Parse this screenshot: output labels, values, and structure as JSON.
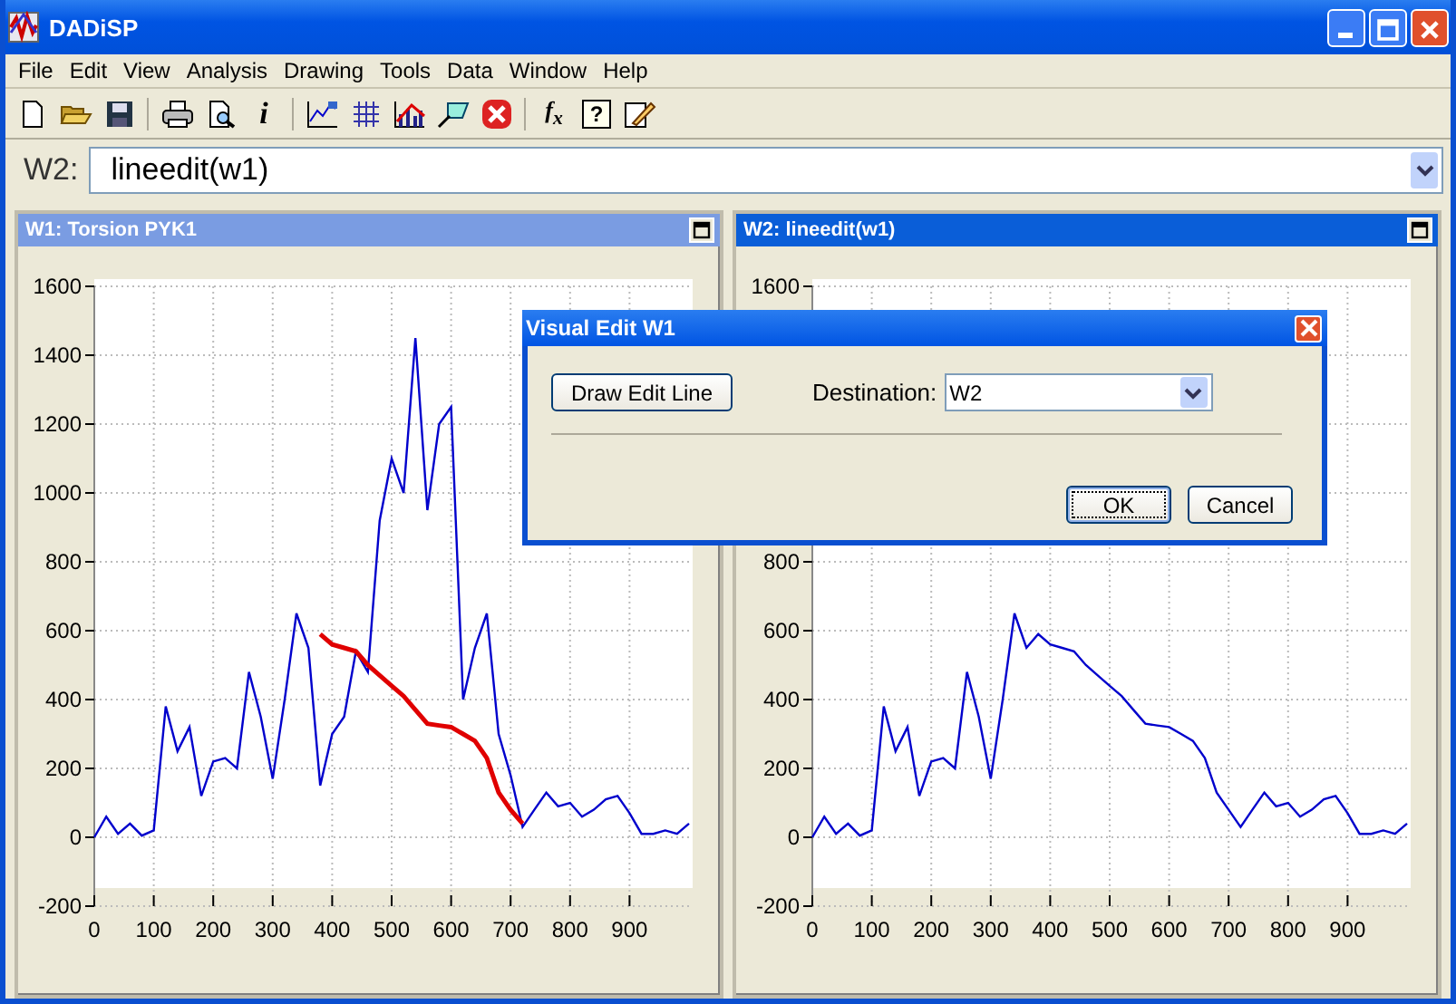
{
  "window": {
    "title": "DADiSP"
  },
  "menu": [
    "File",
    "Edit",
    "View",
    "Analysis",
    "Drawing",
    "Tools",
    "Data",
    "Window",
    "Help"
  ],
  "toolbar": [
    [
      {
        "kind": "new"
      },
      {
        "kind": "open"
      },
      {
        "kind": "save"
      }
    ],
    [
      {
        "kind": "print"
      },
      {
        "kind": "preview"
      },
      {
        "kind": "info",
        "label": "i"
      }
    ],
    [
      {
        "kind": "chart"
      },
      {
        "kind": "grid"
      },
      {
        "kind": "bars"
      },
      {
        "kind": "shape"
      },
      {
        "kind": "stop"
      }
    ],
    [
      {
        "kind": "fx",
        "label": "f$_{x}$"
      },
      {
        "kind": "help",
        "label": "?"
      },
      {
        "kind": "notes"
      }
    ]
  ],
  "formula_bar": {
    "label": "W2:",
    "value": "lineedit(w1)"
  },
  "windows": [
    {
      "title": "W1: Torsion PYK1",
      "active": false,
      "chart_data": {
        "type": "line",
        "grid": true,
        "xlim": [
          0,
          1000
        ],
        "ylim": [
          -200,
          1600
        ],
        "xticks": [
          0,
          100,
          200,
          300,
          400,
          500,
          600,
          700,
          800,
          900
        ],
        "yticks": [
          -200,
          0,
          200,
          400,
          600,
          800,
          1000,
          1200,
          1400,
          1600
        ],
        "x": [
          0,
          20,
          40,
          60,
          80,
          100,
          120,
          140,
          160,
          180,
          200,
          220,
          240,
          260,
          280,
          300,
          320,
          340,
          360,
          380,
          400,
          420,
          440,
          460,
          480,
          500,
          520,
          540,
          560,
          580,
          600,
          620,
          640,
          660,
          680,
          700,
          720,
          740,
          760,
          780,
          800,
          820,
          840,
          860,
          880,
          900,
          920,
          940,
          960,
          980,
          1000
        ],
        "series": [
          {
            "color": "#0000cc",
            "values": [
              0,
              60,
              10,
              40,
              5,
              20,
              380,
              250,
              320,
              120,
              220,
              230,
              200,
              480,
              350,
              170,
              400,
              650,
              550,
              150,
              300,
              350,
              540,
              480,
              920,
              1100,
              1000,
              1450,
              950,
              1200,
              1250,
              400,
              550,
              650,
              300,
              180,
              30,
              80,
              130,
              90,
              100,
              60,
              80,
              110,
              120,
              70,
              10,
              10,
              20,
              10,
              40
            ]
          },
          {
            "color": "#e00000",
            "values": [
              null,
              null,
              null,
              null,
              null,
              null,
              null,
              null,
              null,
              null,
              null,
              null,
              null,
              null,
              null,
              null,
              null,
              null,
              null,
              590,
              560,
              550,
              540,
              500,
              470,
              440,
              410,
              370,
              330,
              325,
              320,
              300,
              280,
              230,
              130,
              80,
              40,
              null,
              null,
              null,
              null,
              null,
              null,
              null,
              null,
              null,
              null,
              null,
              null,
              null,
              null
            ]
          }
        ]
      }
    },
    {
      "title": "W2: lineedit(w1)",
      "active": true,
      "chart_data": {
        "type": "line",
        "grid": true,
        "xlim": [
          0,
          1000
        ],
        "ylim": [
          -200,
          1600
        ],
        "xticks": [
          0,
          100,
          200,
          300,
          400,
          500,
          600,
          700,
          800,
          900
        ],
        "yticks": [
          -200,
          0,
          200,
          400,
          600,
          800,
          1600
        ],
        "x": [
          0,
          20,
          40,
          60,
          80,
          100,
          120,
          140,
          160,
          180,
          200,
          220,
          240,
          260,
          280,
          300,
          320,
          340,
          360,
          380,
          400,
          420,
          440,
          460,
          480,
          500,
          520,
          540,
          560,
          580,
          600,
          620,
          640,
          660,
          680,
          700,
          720,
          740,
          760,
          780,
          800,
          820,
          840,
          860,
          880,
          900,
          920,
          940,
          960,
          980,
          1000
        ],
        "series": [
          {
            "color": "#0000cc",
            "values": [
              0,
              60,
              10,
              40,
              5,
              20,
              380,
              250,
              320,
              120,
              220,
              230,
              200,
              480,
              350,
              170,
              400,
              650,
              550,
              590,
              560,
              550,
              540,
              500,
              470,
              440,
              410,
              370,
              330,
              325,
              320,
              300,
              280,
              230,
              130,
              80,
              30,
              80,
              130,
              90,
              100,
              60,
              80,
              110,
              120,
              70,
              10,
              10,
              20,
              10,
              40
            ]
          }
        ]
      }
    }
  ],
  "dialog": {
    "title": "Visual Edit W1",
    "draw_button": "Draw Edit Line",
    "destination_label": "Destination:",
    "destination_value": "W2",
    "buttons": [
      {
        "label": "OK",
        "default": true
      },
      {
        "label": "Cancel",
        "default": false
      }
    ]
  }
}
